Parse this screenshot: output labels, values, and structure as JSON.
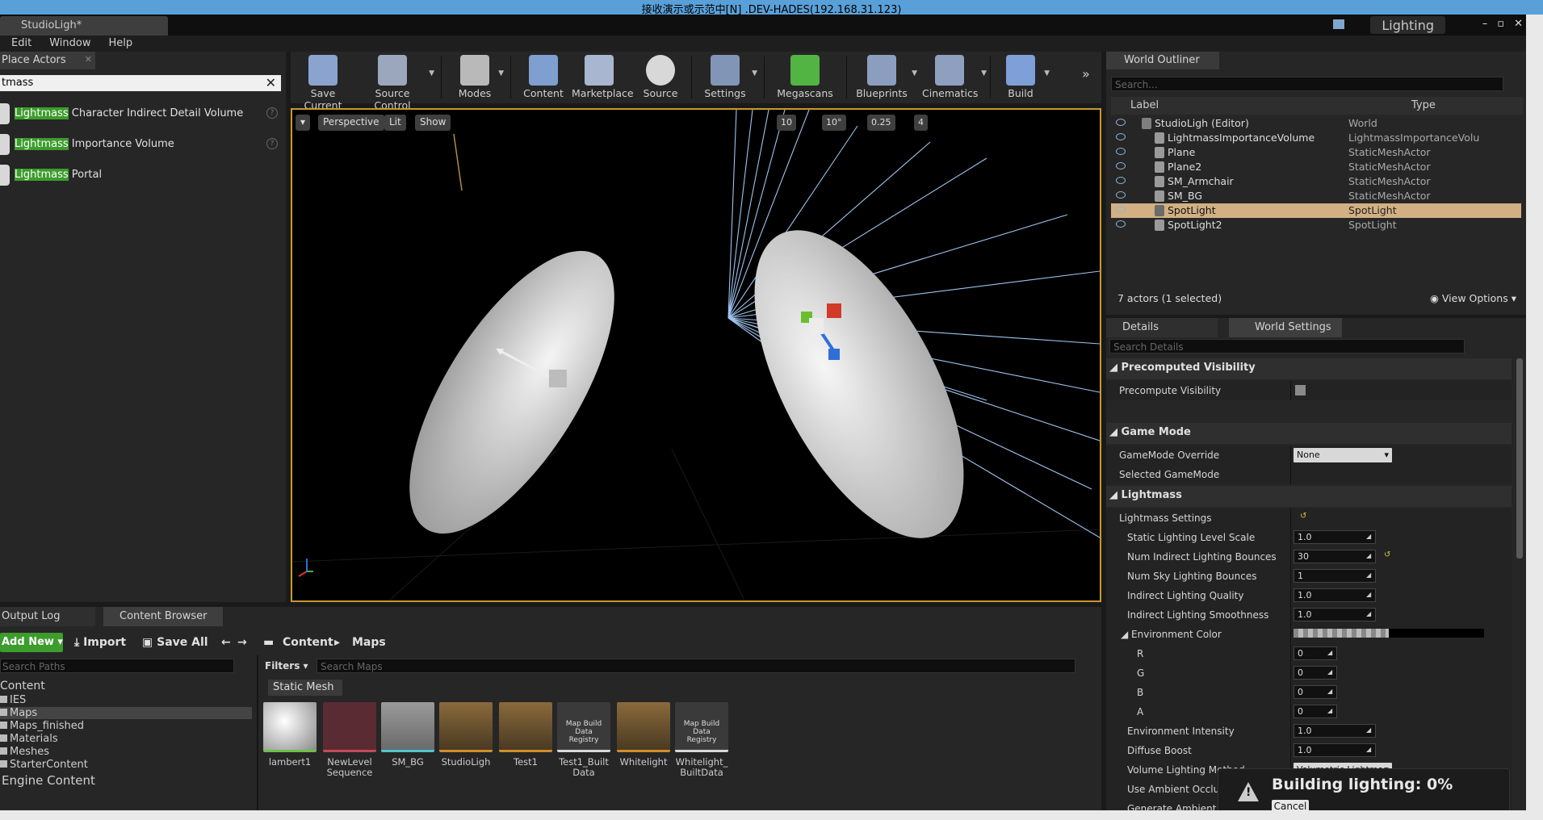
{
  "remote_title": "接收演示或示范中[N] .DEV-HADES(192.168.31.123)",
  "document_tab": "StudioLigh*",
  "lighting_badge": "Lighting",
  "window_controls": [
    "–",
    "▫",
    "✕"
  ],
  "menu": [
    "Edit",
    "Window",
    "Help"
  ],
  "place_actors": {
    "tab_label": "Place Actors",
    "search_value": "tmass",
    "items": [
      {
        "highlight": "Lightmass",
        "rest": " Character Indirect Detail Volume"
      },
      {
        "highlight": "Lightmass",
        "rest": " Importance Volume"
      },
      {
        "highlight": "Lightmass",
        "rest": " Portal"
      }
    ]
  },
  "toolbar": {
    "buttons": [
      "Save Current",
      "Source Control",
      "Modes",
      "Content",
      "Marketplace",
      "Source",
      "Settings",
      "Megascans",
      "Blueprints",
      "Cinematics",
      "Build"
    ]
  },
  "viewport": {
    "perspective": "Perspective",
    "lit": "Lit",
    "show": "Show",
    "grid_snap": "10",
    "rot_snap": "10°",
    "scale_snap": "0.25",
    "cam_speed": "4"
  },
  "bottom": {
    "tabs": [
      "Output Log",
      "Content Browser"
    ],
    "add_new": "Add New",
    "import": "Import",
    "save_all": "Save All",
    "breadcrumb": [
      "Content",
      "Maps"
    ],
    "search_paths_placeholder": "Search Paths",
    "tree_root": "Content",
    "tree": [
      "IES",
      "Maps",
      "Maps_finished",
      "Materials",
      "Meshes",
      "StarterContent"
    ],
    "engine_content": "Engine Content",
    "filters": "Filters",
    "search_maps_placeholder": "Search Maps",
    "asset_type_label": "Static Mesh",
    "assets": [
      {
        "name": "lambert1",
        "thumb_text": ""
      },
      {
        "name": "NewLevel Sequence",
        "thumb_text": ""
      },
      {
        "name": "SM_BG",
        "thumb_text": ""
      },
      {
        "name": "StudioLigh",
        "thumb_text": ""
      },
      {
        "name": "Test1",
        "thumb_text": ""
      },
      {
        "name": "Test1_Built Data",
        "thumb_text": "Map Build Data Registry"
      },
      {
        "name": "Whitelight",
        "thumb_text": ""
      },
      {
        "name": "Whitelight_ BuiltData",
        "thumb_text": "Map Build Data Registry"
      }
    ]
  },
  "outliner": {
    "tab": "World Outliner",
    "search_placeholder": "Search...",
    "col_label": "Label",
    "col_type": "Type",
    "rows": [
      {
        "name": "StudioLigh (Editor)",
        "type": "World"
      },
      {
        "name": "LightmassImportanceVolume",
        "type": "LightmassImportanceVolu"
      },
      {
        "name": "Plane",
        "type": "StaticMeshActor"
      },
      {
        "name": "Plane2",
        "type": "StaticMeshActor"
      },
      {
        "name": "SM_Armchair",
        "type": "StaticMeshActor"
      },
      {
        "name": "SM_BG",
        "type": "StaticMeshActor"
      },
      {
        "name": "SpotLight",
        "type": "SpotLight"
      },
      {
        "name": "SpotLight2",
        "type": "SpotLight"
      }
    ],
    "status": "7 actors (1 selected)",
    "view_options": "View Options"
  },
  "details": {
    "tabs": [
      "Details",
      "World Settings"
    ],
    "search_placeholder": "Search Details",
    "categories": {
      "precomputed_visibility": "Precomputed Visibility",
      "game_mode": "Game Mode",
      "lightmass": "Lightmass"
    },
    "precompute_visibility": "Precompute Visibility",
    "gamemode_override": "GameMode Override",
    "gamemode_value": "None",
    "selected_gamemode": "Selected GameMode",
    "lightmass_settings": "Lightmass Settings",
    "props": [
      {
        "name": "Static Lighting Level Scale",
        "value": "1.0"
      },
      {
        "name": "Num Indirect Lighting Bounces",
        "value": "30"
      },
      {
        "name": "Num Sky Lighting Bounces",
        "value": "1"
      },
      {
        "name": "Indirect Lighting Quality",
        "value": "1.0"
      },
      {
        "name": "Indirect Lighting Smoothness",
        "value": "1.0"
      }
    ],
    "environment_color": "Environment Color",
    "rgba": [
      {
        "name": "R",
        "value": "0"
      },
      {
        "name": "G",
        "value": "0"
      },
      {
        "name": "B",
        "value": "0"
      },
      {
        "name": "A",
        "value": "0"
      }
    ],
    "env_intensity": {
      "name": "Environment Intensity",
      "value": "1.0"
    },
    "diffuse_boost": {
      "name": "Diffuse Boost",
      "value": "1.0"
    },
    "volume_lighting": {
      "name": "Volume Lighting Method",
      "value": "Volumetric Lightmap"
    },
    "use_ambient": "Use Ambient Occlusio",
    "generate_ambient": "Generate Ambient Occ"
  },
  "notification": {
    "message": "Building lighting:  0%",
    "cancel": "Cancel"
  }
}
